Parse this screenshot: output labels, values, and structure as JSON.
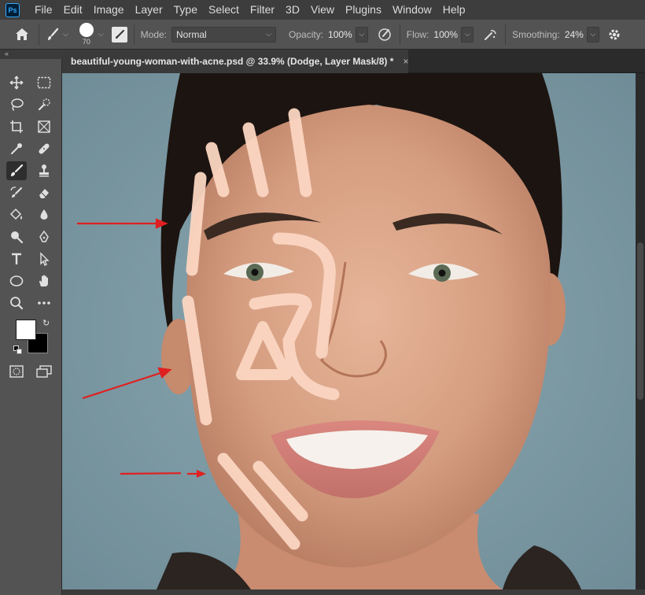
{
  "app": {
    "logo": "Ps"
  },
  "menu": [
    "File",
    "Edit",
    "Image",
    "Layer",
    "Type",
    "Select",
    "Filter",
    "3D",
    "View",
    "Plugins",
    "Window",
    "Help"
  ],
  "options": {
    "brush_size": "70",
    "mode_label": "Mode:",
    "mode_value": "Normal",
    "opacity_label": "Opacity:",
    "opacity_value": "100%",
    "flow_label": "Flow:",
    "flow_value": "100%",
    "smoothing_label": "Smoothing:",
    "smoothing_value": "24%"
  },
  "document": {
    "tab_title": "beautiful-young-woman-with-acne.psd @ 33.9% (Dodge, Layer Mask/8) *",
    "close_glyph": "×"
  },
  "colors": {
    "foreground": "#ffffff",
    "background": "#000000",
    "canvas_bg": "#7c9aa5",
    "annotation_arrow": "#e02020",
    "dodge_stroke": "#fbd6c2"
  },
  "icons": {
    "home": "home-icon",
    "brush": "brush-icon",
    "settings": "gear-icon"
  }
}
